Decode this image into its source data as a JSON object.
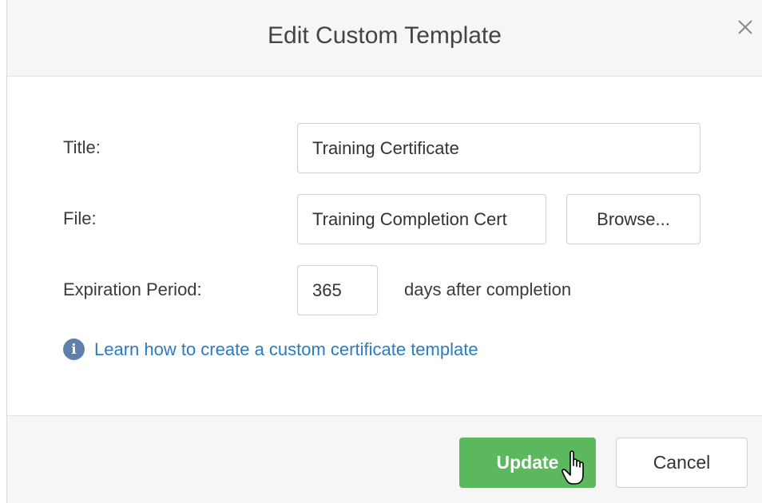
{
  "dialog": {
    "title": "Edit Custom Template",
    "close_icon": "close-icon"
  },
  "form": {
    "title_label": "Title:",
    "title_value": "Training Certificate",
    "file_label": "File:",
    "file_value": "Training Completion Cert",
    "browse_label": "Browse...",
    "expiration_label": "Expiration Period:",
    "expiration_value": "365",
    "expiration_suffix": "days after completion"
  },
  "help": {
    "icon": "info-icon",
    "link_text": "Learn how to create a custom certificate template"
  },
  "footer": {
    "update_label": "Update",
    "cancel_label": "Cancel"
  },
  "colors": {
    "primary_button": "#5cb85c",
    "link": "#2c7ac0",
    "info_icon": "#5f80ad"
  }
}
